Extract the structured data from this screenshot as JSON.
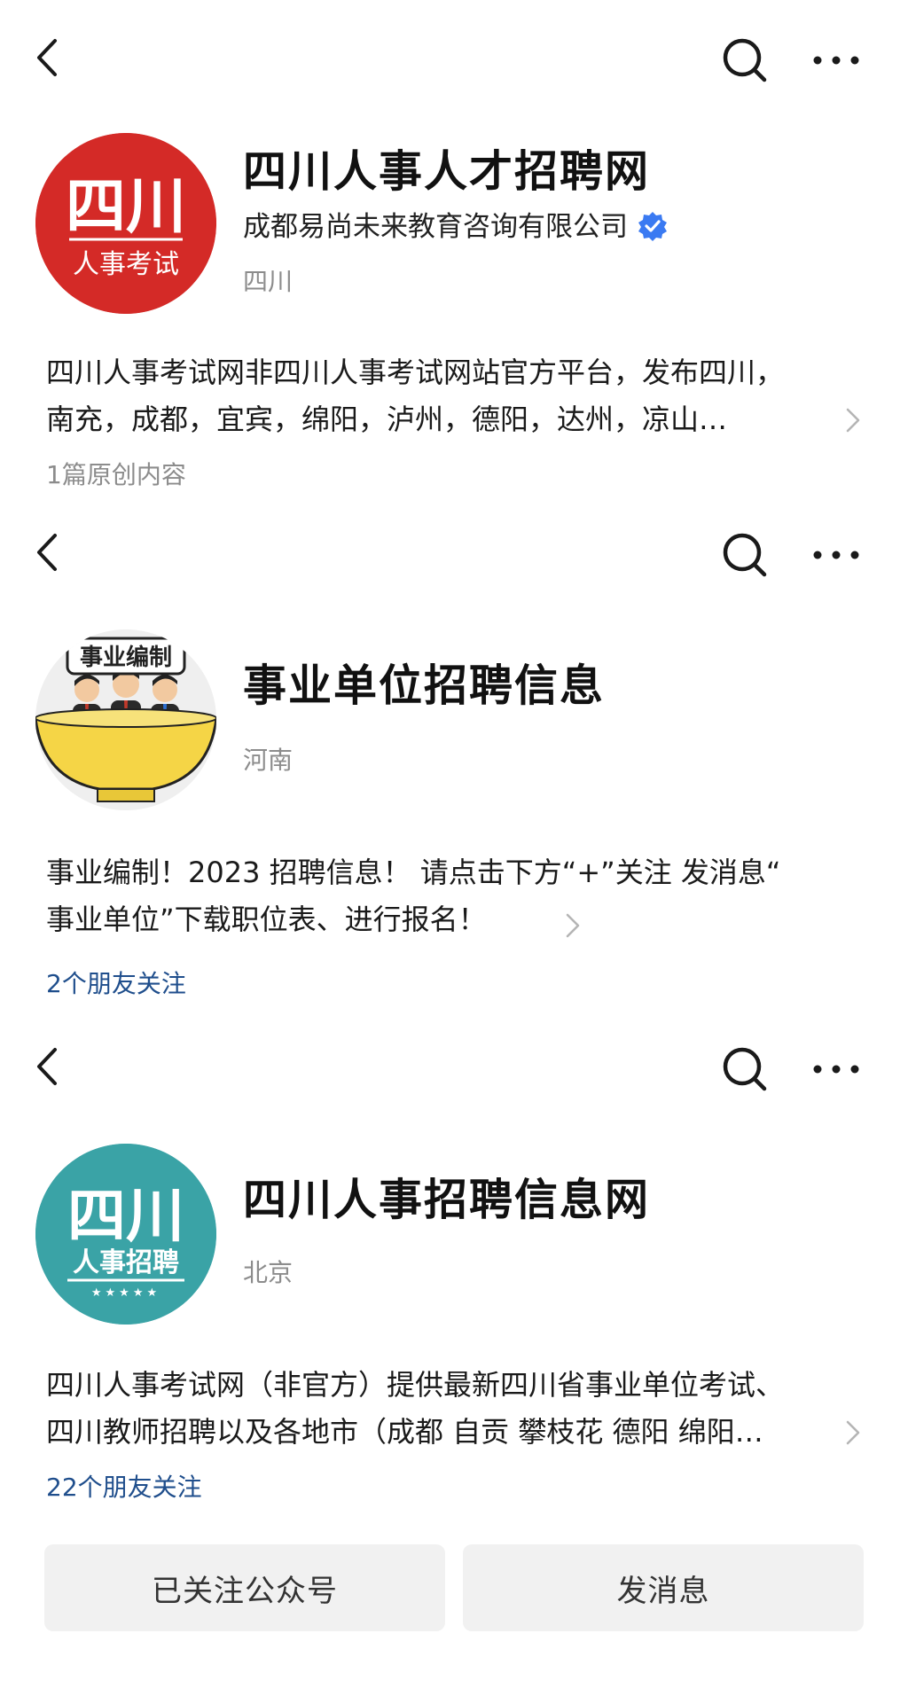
{
  "colors": {
    "verified_blue": "#3a7af2",
    "link_blue": "#1f4e8c",
    "muted": "#8c8c8c",
    "button_bg": "#f1f1f1"
  },
  "icons": {
    "back": "chevron-left-icon",
    "search": "search-icon",
    "more": "more-icon"
  },
  "accounts": [
    {
      "name": "四川人事人才招聘网",
      "company": "成都易尚未来教育咨询有限公司",
      "verified": true,
      "region": "四川",
      "avatar": {
        "line1": "四川",
        "line2": "人事考试",
        "bg": "#d42a27"
      },
      "desc_lines": [
        "四川人事考试网非四川人事考试网站官方平台，发布四川，",
        "南充，成都，宜宾，绵阳，泸州，德阳，达州，凉山…"
      ],
      "meta": "1篇原创内容"
    },
    {
      "name": "事业单位招聘信息",
      "region": "河南",
      "avatar": {
        "label": "事业编制"
      },
      "desc_lines": [
        "事业编制！2023 招聘信息！ 请点击下方“+”关注 发消息“",
        "事业单位”下载职位表、进行报名！"
      ],
      "meta": "2个朋友关注"
    },
    {
      "name": "四川人事招聘信息网",
      "region": "北京",
      "avatar": {
        "line1": "四川",
        "line2": "人事招聘",
        "stars": "★★★★★",
        "bg": "#3aa3a6"
      },
      "desc_lines": [
        "四川人事考试网（非官方）提供最新四川省事业单位考试、",
        "四川教师招聘以及各地市（成都 自贡 攀枝花 德阳 绵阳…"
      ],
      "meta": "22个朋友关注"
    }
  ],
  "actions": {
    "follow_label": "已关注公众号",
    "message_label": "发消息"
  }
}
